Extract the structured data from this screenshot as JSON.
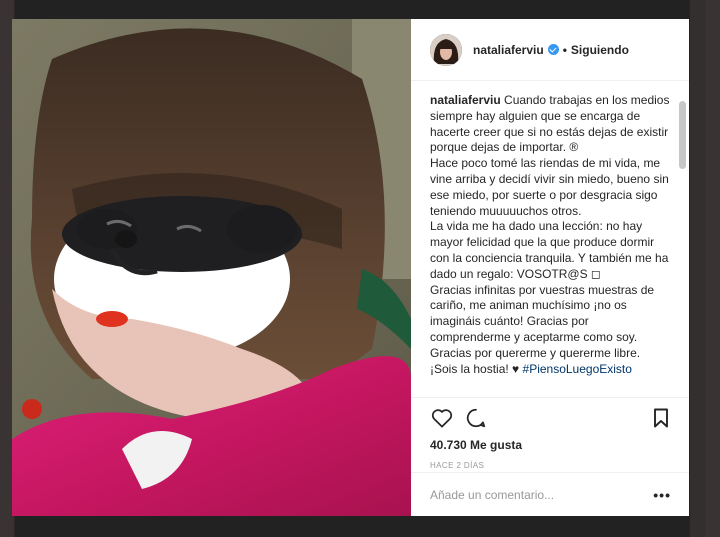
{
  "header": {
    "username": "nataliaferviu",
    "separator": "•",
    "follow_status": "Siguiendo"
  },
  "caption": {
    "username": "nataliaferviu",
    "paragraphs": [
      "Cuando trabajas en los medios siempre hay alguien que se encarga de hacerte creer que si no estás dejas de existir porque dejas de importar. ®",
      "Hace poco tomé las riendas de mi vida, me vine arriba y decidí vivir sin miedo, bueno sin ese miedo, por suerte o por desgracia sigo teniendo muuuuuchos otros.",
      "La vida me ha dado una lección: no hay mayor felicidad que la que produce dormir con la conciencia tranquila. Y también me ha dado un regalo: VOSOTR@S ◻",
      "Gracias infinitas por vuestras muestras de cariño, me animan muchísimo ¡no os imagináis cuánto! Gracias por comprenderme y aceptarme como soy. Gracias por quererme y quererme libre.",
      "¡Sois la hostia! ♥"
    ],
    "hashtag": "#PiensoLuegoExisto"
  },
  "actions": {
    "icons": [
      "heart-icon",
      "comment-icon",
      "bookmark-icon"
    ],
    "likes": "40.730 Me gusta",
    "time": "HACE 2 DÍAS"
  },
  "comment": {
    "placeholder": "Añade un comentario...",
    "more": "•••"
  },
  "colors": {
    "accent": "#3897f0",
    "text": "#262626",
    "muted": "#999999",
    "hashtag": "#003569",
    "photo_background": "#d81b60"
  }
}
